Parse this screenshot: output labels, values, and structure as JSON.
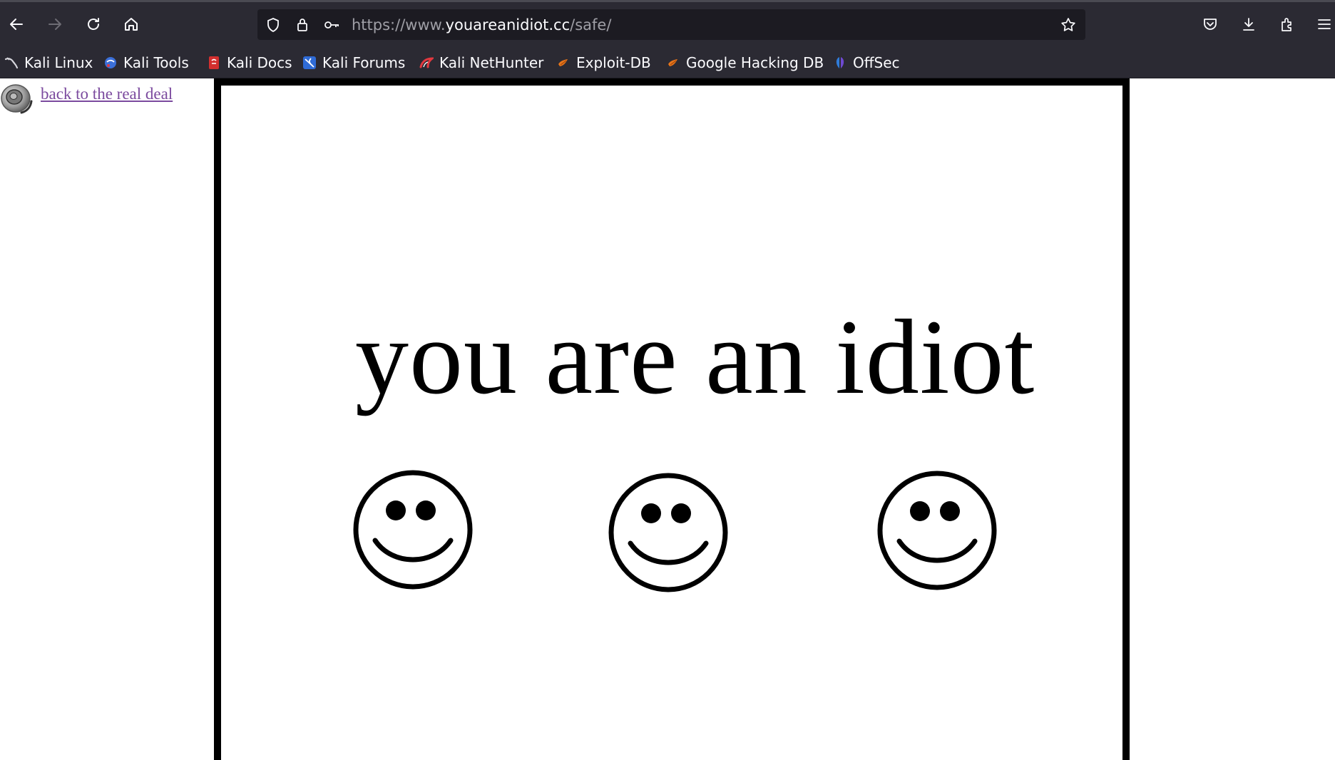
{
  "browser": {
    "url_prefix": "https://www.",
    "url_host": "youareanidiot.cc",
    "url_path": "/safe/"
  },
  "bookmarks": [
    {
      "label": "Kali Linux",
      "icon": "kali-dragon-icon"
    },
    {
      "label": "Kali Tools",
      "icon": "kali-tools-icon"
    },
    {
      "label": "Kali Docs",
      "icon": "kali-docs-icon"
    },
    {
      "label": "Kali Forums",
      "icon": "kali-forums-icon"
    },
    {
      "label": "Kali NetHunter",
      "icon": "kali-nethunter-icon"
    },
    {
      "label": "Exploit-DB",
      "icon": "exploit-db-icon"
    },
    {
      "label": "Google Hacking DB",
      "icon": "google-hacking-db-icon"
    },
    {
      "label": "OffSec",
      "icon": "offsec-icon"
    }
  ],
  "page": {
    "link_label": "back to the real deal",
    "headline": "you are an idiot",
    "smiley_icons": [
      "smiley-face-icon",
      "smiley-face-icon",
      "smiley-face-icon"
    ]
  },
  "colors": {
    "chrome_bg": "#2b2a33",
    "url_bg": "#1c1b22",
    "link_visited": "#7b4a9e",
    "frame_border": "#000000"
  }
}
